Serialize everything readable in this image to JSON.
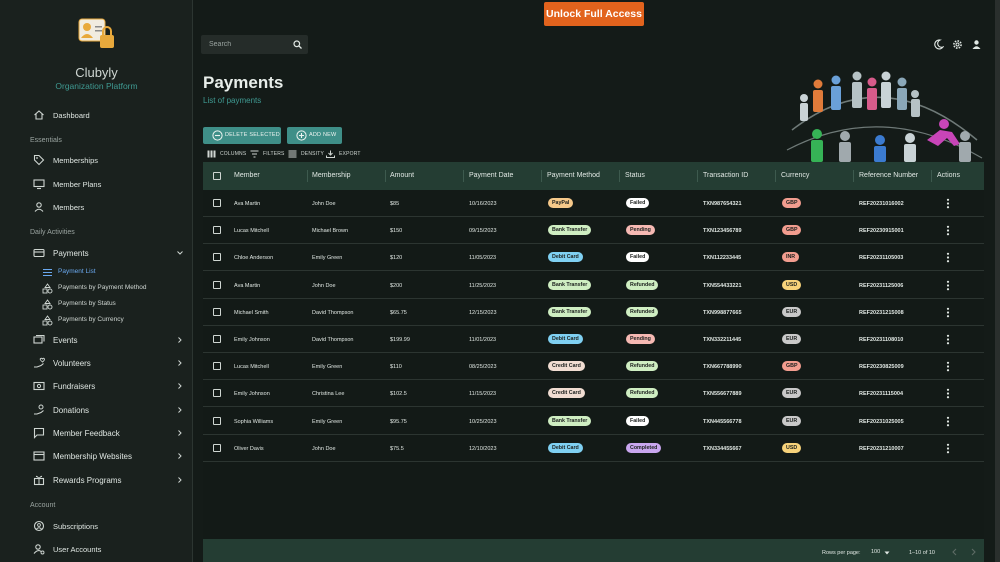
{
  "brand": {
    "name": "Clubyly",
    "subtitle": "Organization Platform",
    "logo_icon": "user-lock-icon"
  },
  "topbar": {
    "unlock_label": "Unlock Full Access",
    "search_placeholder": "Search",
    "icons": [
      "moon-icon",
      "gear-icon",
      "user-icon"
    ]
  },
  "sidebar": {
    "dashboard": "Dashboard",
    "sections": {
      "essentials": "Essentials",
      "daily": "Daily Activities",
      "account": "Account"
    },
    "essentials": [
      "Memberships",
      "Member Plans",
      "Members"
    ],
    "payments": "Payments",
    "payments_sub": [
      "Payment List",
      "Payments by Payment Method",
      "Payments by Status",
      "Payments by Currency"
    ],
    "daily": [
      "Events",
      "Volunteers",
      "Fundraisers",
      "Donations",
      "Member Feedback",
      "Membership Websites",
      "Rewards Programs"
    ],
    "account": [
      "Subscriptions",
      "User Accounts"
    ]
  },
  "page": {
    "title": "Payments",
    "subtitle": "List of payments"
  },
  "actions": {
    "delete_selected": "DELETE SELECTED",
    "add_new": "ADD NEW"
  },
  "toolbar": {
    "columns": "COLUMNS",
    "filters": "FILTERS",
    "density": "DENSITY",
    "export": "EXPORT"
  },
  "table": {
    "columns": [
      "Member",
      "Membership",
      "Amount",
      "Payment Date",
      "Payment Method",
      "Status",
      "Transaction ID",
      "Currency",
      "Reference Number",
      "Actions"
    ],
    "rows": [
      [
        "Ava Martin",
        "John Doe",
        "$85",
        "10/16/2023",
        "PayPal",
        "Failed",
        "TXN987654321",
        "GBP",
        "REF20231016002"
      ],
      [
        "Lucas Mitchell",
        "Michael Brown",
        "$150",
        "09/15/2023",
        "Bank Transfer",
        "Pending",
        "TXN123456789",
        "GBP",
        "REF20230915001"
      ],
      [
        "Chloe Anderson",
        "Emily Green",
        "$120",
        "11/05/2023",
        "Debit Card",
        "Failed",
        "TXN112233445",
        "INR",
        "REF20231105003"
      ],
      [
        "Ava Martin",
        "John Doe",
        "$200",
        "11/25/2023",
        "Bank Transfer",
        "Refunded",
        "TXN554433221",
        "USD",
        "REF20231125006"
      ],
      [
        "Michael Smith",
        "David Thompson",
        "$65.75",
        "12/15/2023",
        "Bank Transfer",
        "Refunded",
        "TXN998877665",
        "EUR",
        "REF20231215008"
      ],
      [
        "Emily Johnson",
        "David Thompson",
        "$199.99",
        "11/01/2023",
        "Debit Card",
        "Pending",
        "TXN332211445",
        "EUR",
        "REF20231108010"
      ],
      [
        "Lucas Mitchell",
        "Emily Green",
        "$110",
        "08/25/2023",
        "Credit Card",
        "Refunded",
        "TXN667788990",
        "GBP",
        "REF20230825009"
      ],
      [
        "Emily Johnson",
        "Christina Lee",
        "$102.5",
        "11/15/2023",
        "Credit Card",
        "Refunded",
        "TXN556677889",
        "EUR",
        "REF20231115004"
      ],
      [
        "Sophia Williams",
        "Emily Green",
        "$95.75",
        "10/25/2023",
        "Bank Transfer",
        "Failed",
        "TXN445566778",
        "EUR",
        "REF20231025005"
      ],
      [
        "Oliver Davis",
        "John Doe",
        "$75.5",
        "12/10/2023",
        "Debit Card",
        "Completed",
        "TXN334455667",
        "USD",
        "REF20231210007"
      ]
    ]
  },
  "footer": {
    "rows_per_page_label": "Rows per page:",
    "rows_per_page": "100",
    "range": "1–10 of 10"
  },
  "colors": {
    "accent": "#3f8f88",
    "unlock": "#e2631d",
    "active_link": "#6aa9f0",
    "method": {
      "PayPal": "#f6c98a",
      "Bank Transfer": "#cfeec2",
      "Debit Card": "#7fd0f2",
      "Credit Card": "#f1ddd2"
    },
    "status": {
      "Failed": "#ffffff",
      "Pending": "#f6b9b3",
      "Refunded": "#cfeec2",
      "Completed": "#c9a6ef"
    },
    "currency": {
      "GBP": "#f29d8f",
      "INR": "#f29d8f",
      "USD": "#f7d27a",
      "EUR": "#c9c9c9"
    }
  }
}
